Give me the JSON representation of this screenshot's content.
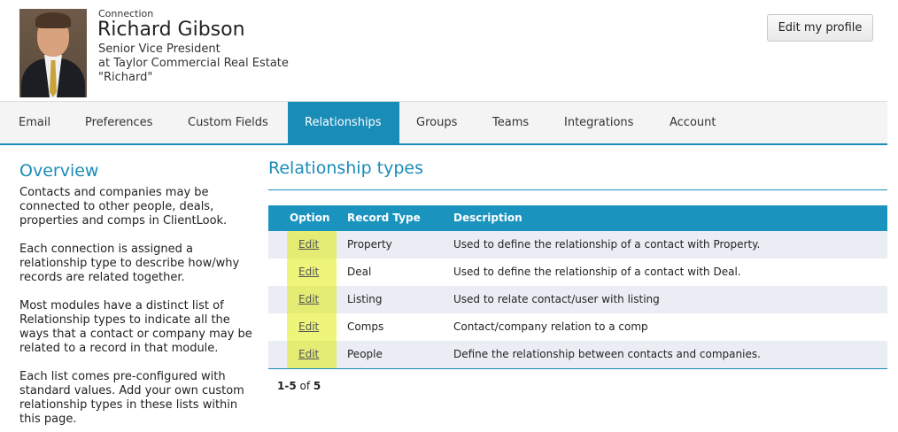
{
  "profile": {
    "connection_label": "Connection",
    "name": "Richard Gibson",
    "title": "Senior Vice President",
    "company": "at Taylor Commercial Real Estate",
    "nickname": "\"Richard\"",
    "edit_button": "Edit my profile"
  },
  "tabs": [
    {
      "label": "Email",
      "active": false
    },
    {
      "label": "Preferences",
      "active": false
    },
    {
      "label": "Custom Fields",
      "active": false
    },
    {
      "label": "Relationships",
      "active": true
    },
    {
      "label": "Groups",
      "active": false
    },
    {
      "label": "Teams",
      "active": false
    },
    {
      "label": "Integrations",
      "active": false
    },
    {
      "label": "Account",
      "active": false
    }
  ],
  "sidebar": {
    "title": "Overview",
    "paragraphs": [
      "Contacts and companies may be connected to other people, deals, properties and comps in ClientLook.",
      "Each connection is assigned a relationship type to describe how/why records are related together.",
      "Most modules have a distinct list of Relationship types to indicate all the ways that a contact or company may be related to a record in that module.",
      "Each list comes pre-configured with standard values. Add your own custom relationship types in these lists within this page."
    ]
  },
  "main": {
    "title": "Relationship types",
    "columns": {
      "option": "Option",
      "record_type": "Record Type",
      "description": "Description"
    },
    "rows": [
      {
        "option": "Edit",
        "record_type": "Property",
        "description": "Used to define the relationship of a contact with Property."
      },
      {
        "option": "Edit",
        "record_type": "Deal",
        "description": "Used to define the relationship of a contact with Deal."
      },
      {
        "option": "Edit",
        "record_type": "Listing",
        "description": "Used to relate contact/user with listing"
      },
      {
        "option": "Edit",
        "record_type": "Comps",
        "description": "Contact/company relation to a comp"
      },
      {
        "option": "Edit",
        "record_type": "People",
        "description": "Define the relationship between contacts and companies."
      }
    ],
    "pager": {
      "range": "1-5",
      "of": "of",
      "total": "5"
    }
  },
  "colors": {
    "accent": "#1a8cb8",
    "table_header": "#1a93bf",
    "highlight": "#eef57a",
    "row_alt": "#eaeef4"
  }
}
